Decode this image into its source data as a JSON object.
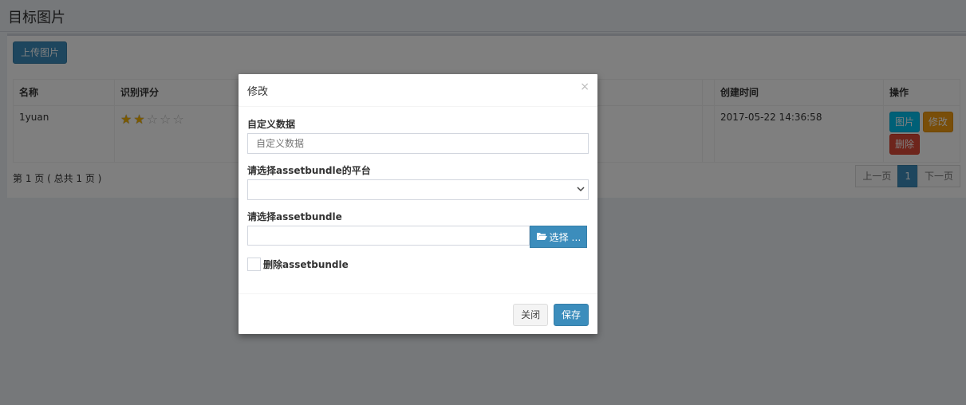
{
  "page": {
    "title": "目标图片",
    "upload_label": "上传图片"
  },
  "table": {
    "headers": [
      "名称",
      "识别评分",
      "",
      "创建时间",
      "操作"
    ],
    "rows": [
      {
        "name": "1yuan",
        "rating": 2,
        "rating_max": 5,
        "created": "2017-05-22 14:36:58",
        "actions": [
          "图片",
          "修改",
          "删除"
        ]
      }
    ]
  },
  "pagination": {
    "summary": "第 1 页 ( 总共 1 页 )",
    "prev": "上一页",
    "current": "1",
    "next": "下一页"
  },
  "modal": {
    "title": "修改",
    "close_glyph": "×",
    "custom_data_label": "自定义数据",
    "custom_data_placeholder": "自定义数据",
    "platform_label": "请选择assetbundle的平台",
    "platform_value": "",
    "bundle_label": "请选择assetbundle",
    "bundle_value": "",
    "choose_label": "选择 …",
    "delete_bundle_label": "删除assetbundle",
    "close_label": "关闭",
    "save_label": "保存"
  },
  "colors": {
    "primary": "#3c8dbc",
    "info": "#00c0ef",
    "warning": "#f39c12",
    "danger": "#dd4b39"
  }
}
